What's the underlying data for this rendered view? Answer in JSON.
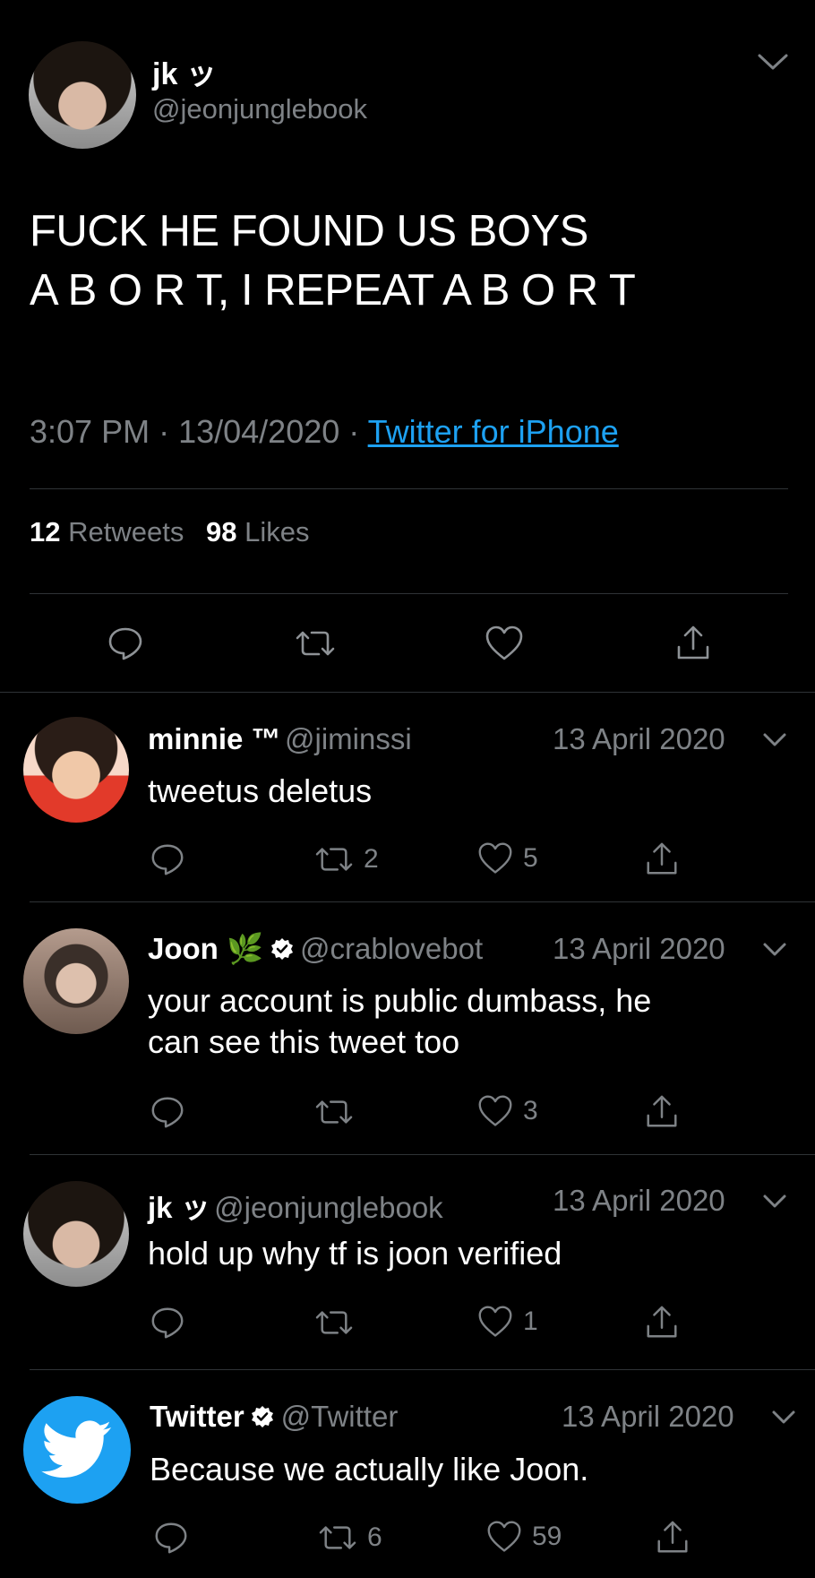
{
  "main_tweet": {
    "display_name": "jk ッ",
    "handle": "@jeonjunglebook",
    "text_line1": "FUCK HE FOUND US BOYS",
    "text_line2": "A B O R T, I REPEAT A B O R T",
    "time": "3:07 PM",
    "date": "13/04/2020",
    "source": "Twitter for iPhone",
    "retweets_count": "12",
    "retweets_label": "Retweets",
    "likes_count": "98",
    "likes_label": "Likes"
  },
  "replies": [
    {
      "name": "minnie ™",
      "handle": "@jiminssi",
      "date": "13 April 2020",
      "text": "tweetus deletus",
      "retweets": "2",
      "likes": "5"
    },
    {
      "name": "Joon 🌿",
      "handle": "@crablovebot",
      "date": "13 April 2020",
      "text_line1": "your account is public dumbass, he",
      "text_line2": "can see this tweet too",
      "likes": "3"
    },
    {
      "name": "jk ッ",
      "handle": "@jeonjunglebook",
      "date": "13 April 2020",
      "text": "hold up why tf is joon verified",
      "likes": "1"
    },
    {
      "name": "Twitter",
      "handle": "@Twitter",
      "date": "13 April 2020",
      "text": "Because we actually like Joon.",
      "retweets": "6",
      "likes": "59"
    }
  ],
  "colors": {
    "background": "#000000",
    "text": "#ffffff",
    "secondary": "#7e8286",
    "link": "#1da1f2",
    "divider": "#2f3336"
  },
  "icons": [
    "chevron-down-icon",
    "reply-icon",
    "retweet-icon",
    "like-icon",
    "share-icon",
    "verified-badge-icon",
    "twitter-bird-icon"
  ]
}
